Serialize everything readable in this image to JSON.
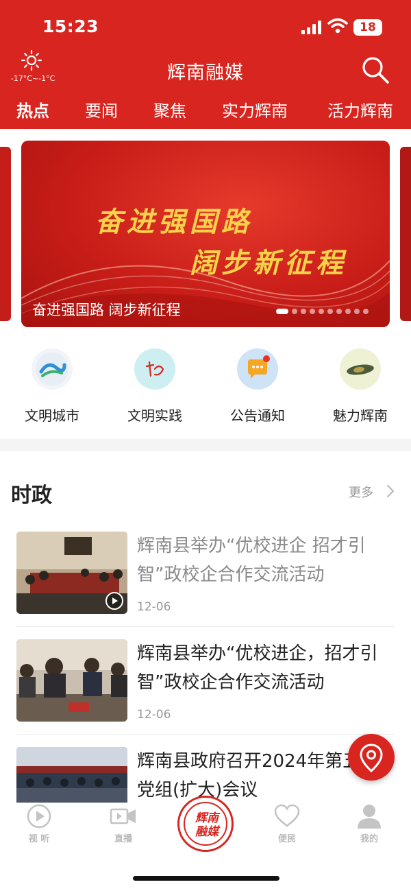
{
  "status_bar": {
    "time": "15:23",
    "battery": "18"
  },
  "header": {
    "weather_temp": "-17°C~-1°C",
    "title": "辉南融媒",
    "tabs": [
      "热点",
      "要闻",
      "聚焦",
      "实力辉南",
      "活力辉南"
    ],
    "active_tab": "热点"
  },
  "banner": {
    "line1": "奋进强国路",
    "line2": "阔步新征程",
    "caption": "奋进强国路  阔步新征程",
    "slide_count": 10,
    "active_slide": 0
  },
  "quick_links": [
    {
      "label": "文明城市",
      "icon": "civilized-city-icon"
    },
    {
      "label": "文明实践",
      "icon": "civilized-practice-icon"
    },
    {
      "label": "公告通知",
      "icon": "announcement-chat-icon"
    },
    {
      "label": "魅力辉南",
      "icon": "charm-huinan-icon"
    }
  ],
  "news_section": {
    "title": "时政",
    "more_label": "更多",
    "items": [
      {
        "title": "辉南县举办“优校进企 招才引智”政校企合作交流活动",
        "date": "12-06",
        "has_video": true,
        "read": true
      },
      {
        "title": "辉南县举办“优校进企，招才引智”政校企合作交流活动",
        "date": "12-06",
        "has_video": false,
        "read": false
      },
      {
        "title": "辉南县政府召开2024年第五次党组(扩大)会议",
        "date": "",
        "has_video": false,
        "read": false
      }
    ]
  },
  "bottom_nav": {
    "items": [
      {
        "label": "视 听",
        "icon": "play-circle-icon"
      },
      {
        "label": "直播",
        "icon": "video-camera-icon"
      },
      {
        "label": "便民",
        "icon": "heart-icon"
      },
      {
        "label": "我的",
        "icon": "user-icon"
      }
    ],
    "center_logo_text": "辉南融媒"
  },
  "colors": {
    "brand_red": "#d8251f",
    "gold": "#f8d24a"
  }
}
